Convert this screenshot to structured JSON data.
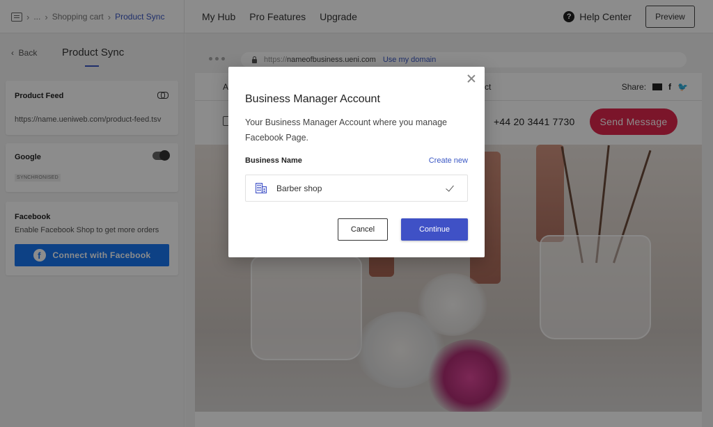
{
  "breadcrumb": {
    "icon": "menu-list-icon",
    "items": [
      "...",
      "Shopping cart",
      "Product Sync"
    ]
  },
  "topnav": {
    "items": [
      "My Hub",
      "Pro Features",
      "Upgrade"
    ]
  },
  "header_right": {
    "help_label": "Help Center",
    "help_icon": "question-circle-icon",
    "preview_label": "Preview"
  },
  "sidebar": {
    "back_label": "Back",
    "title": "Product Sync",
    "product_feed": {
      "title": "Product Feed",
      "url": "https://name.ueniweb.com/product-feed.tsv",
      "icon": "link-icon"
    },
    "google": {
      "title": "Google",
      "status": "SYNCHRONISED",
      "toggle_on": true
    },
    "facebook": {
      "title": "Facebook",
      "description": "Enable Facebook Shop to get more orders",
      "button_label": "Connect with Facebook",
      "button_color": "#1877f2"
    }
  },
  "browser": {
    "url_protocol": "https://",
    "url_domain": "nameofbusiness.ueni.com",
    "url_action": "Use my domain"
  },
  "site": {
    "nav_left_fragment": "A",
    "nav_right_fragment": "ct",
    "share_label": "Share:",
    "phone": "+44 20 3441 7730",
    "send_label": "Send Message",
    "send_color": "#e0274e"
  },
  "modal": {
    "title": "Business Manager Account",
    "description": "Your Business Manager Account where you manage Facebook Page.",
    "field_label": "Business Name",
    "create_new_label": "Create new",
    "option_label": "Barber shop",
    "option_selected": true,
    "cancel_label": "Cancel",
    "continue_label": "Continue",
    "accent_color": "#3f51c6"
  }
}
